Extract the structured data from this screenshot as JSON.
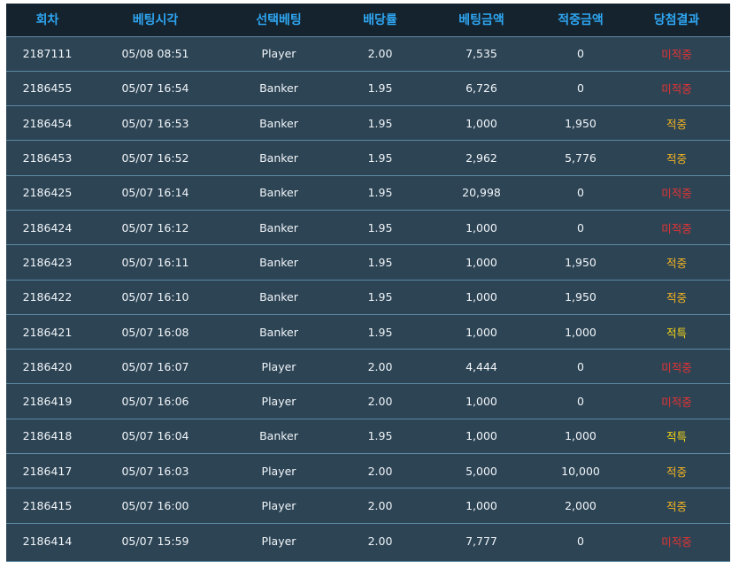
{
  "headers": [
    "회차",
    "베팅시각",
    "선택베팅",
    "배당률",
    "베팅금액",
    "적중금액",
    "당첨결과"
  ],
  "colors": {
    "header_bg": "#14232e",
    "header_text": "#2fa6f2",
    "row_bg": "#2d4455",
    "row_border": "#5d8aa3",
    "cell_text": "#f1f5f8",
    "win": "#f2b320",
    "lose": "#e23434",
    "tie": "#f2d316"
  },
  "rows": [
    {
      "round": "2187111",
      "time": "05/08 08:51",
      "pick": "Player",
      "odds": "2.00",
      "bet": "7,535",
      "payout": "0",
      "result": "미적중",
      "status": "lose"
    },
    {
      "round": "2186455",
      "time": "05/07 16:54",
      "pick": "Banker",
      "odds": "1.95",
      "bet": "6,726",
      "payout": "0",
      "result": "미적중",
      "status": "lose"
    },
    {
      "round": "2186454",
      "time": "05/07 16:53",
      "pick": "Banker",
      "odds": "1.95",
      "bet": "1,000",
      "payout": "1,950",
      "result": "적중",
      "status": "win"
    },
    {
      "round": "2186453",
      "time": "05/07 16:52",
      "pick": "Banker",
      "odds": "1.95",
      "bet": "2,962",
      "payout": "5,776",
      "result": "적중",
      "status": "win"
    },
    {
      "round": "2186425",
      "time": "05/07 16:14",
      "pick": "Banker",
      "odds": "1.95",
      "bet": "20,998",
      "payout": "0",
      "result": "미적중",
      "status": "lose"
    },
    {
      "round": "2186424",
      "time": "05/07 16:12",
      "pick": "Banker",
      "odds": "1.95",
      "bet": "1,000",
      "payout": "0",
      "result": "미적중",
      "status": "lose"
    },
    {
      "round": "2186423",
      "time": "05/07 16:11",
      "pick": "Banker",
      "odds": "1.95",
      "bet": "1,000",
      "payout": "1,950",
      "result": "적중",
      "status": "win"
    },
    {
      "round": "2186422",
      "time": "05/07 16:10",
      "pick": "Banker",
      "odds": "1.95",
      "bet": "1,000",
      "payout": "1,950",
      "result": "적중",
      "status": "win"
    },
    {
      "round": "2186421",
      "time": "05/07 16:08",
      "pick": "Banker",
      "odds": "1.95",
      "bet": "1,000",
      "payout": "1,000",
      "result": "적특",
      "status": "tie"
    },
    {
      "round": "2186420",
      "time": "05/07 16:07",
      "pick": "Player",
      "odds": "2.00",
      "bet": "4,444",
      "payout": "0",
      "result": "미적중",
      "status": "lose"
    },
    {
      "round": "2186419",
      "time": "05/07 16:06",
      "pick": "Player",
      "odds": "2.00",
      "bet": "1,000",
      "payout": "0",
      "result": "미적중",
      "status": "lose"
    },
    {
      "round": "2186418",
      "time": "05/07 16:04",
      "pick": "Banker",
      "odds": "1.95",
      "bet": "1,000",
      "payout": "1,000",
      "result": "적특",
      "status": "tie"
    },
    {
      "round": "2186417",
      "time": "05/07 16:03",
      "pick": "Player",
      "odds": "2.00",
      "bet": "5,000",
      "payout": "10,000",
      "result": "적중",
      "status": "win"
    },
    {
      "round": "2186415",
      "time": "05/07 16:00",
      "pick": "Player",
      "odds": "2.00",
      "bet": "1,000",
      "payout": "2,000",
      "result": "적중",
      "status": "win"
    },
    {
      "round": "2186414",
      "time": "05/07 15:59",
      "pick": "Player",
      "odds": "2.00",
      "bet": "7,777",
      "payout": "0",
      "result": "미적중",
      "status": "lose"
    }
  ]
}
